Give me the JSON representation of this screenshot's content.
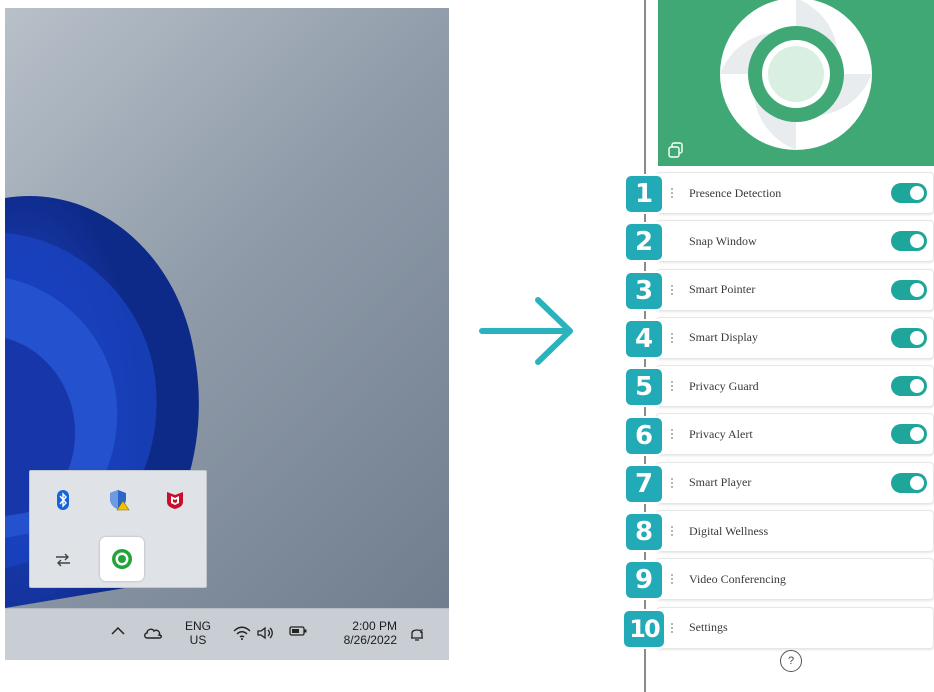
{
  "taskbar": {
    "lang_top": "ENG",
    "lang_bottom": "US",
    "time": "2:00 PM",
    "date": "8/26/2022"
  },
  "tray_flyout": {
    "icons": [
      "bluetooth-icon",
      "windows-security-warning-icon",
      "mcafee-icon",
      "network-transfer-icon",
      "glance-app-icon"
    ]
  },
  "panel": {
    "items": [
      {
        "num": "1",
        "label": "Presence Detection",
        "toggle": true
      },
      {
        "num": "2",
        "label": "Snap Window",
        "toggle": true
      },
      {
        "num": "3",
        "label": "Smart Pointer",
        "toggle": true
      },
      {
        "num": "4",
        "label": "Smart Display",
        "toggle": true
      },
      {
        "num": "5",
        "label": "Privacy Guard",
        "toggle": true
      },
      {
        "num": "6",
        "label": "Privacy Alert",
        "toggle": true
      },
      {
        "num": "7",
        "label": "Smart Player",
        "toggle": true
      },
      {
        "num": "8",
        "label": "Digital Wellness",
        "toggle": false
      },
      {
        "num": "9",
        "label": "Video Conferencing",
        "toggle": false
      },
      {
        "num": "10",
        "label": "Settings",
        "toggle": false
      }
    ],
    "help_label": "?"
  },
  "colors": {
    "hero_green": "#3fa874",
    "toggle_on": "#1ea69b",
    "badge": "#22aab6",
    "arrow": "#2ab3bd"
  }
}
